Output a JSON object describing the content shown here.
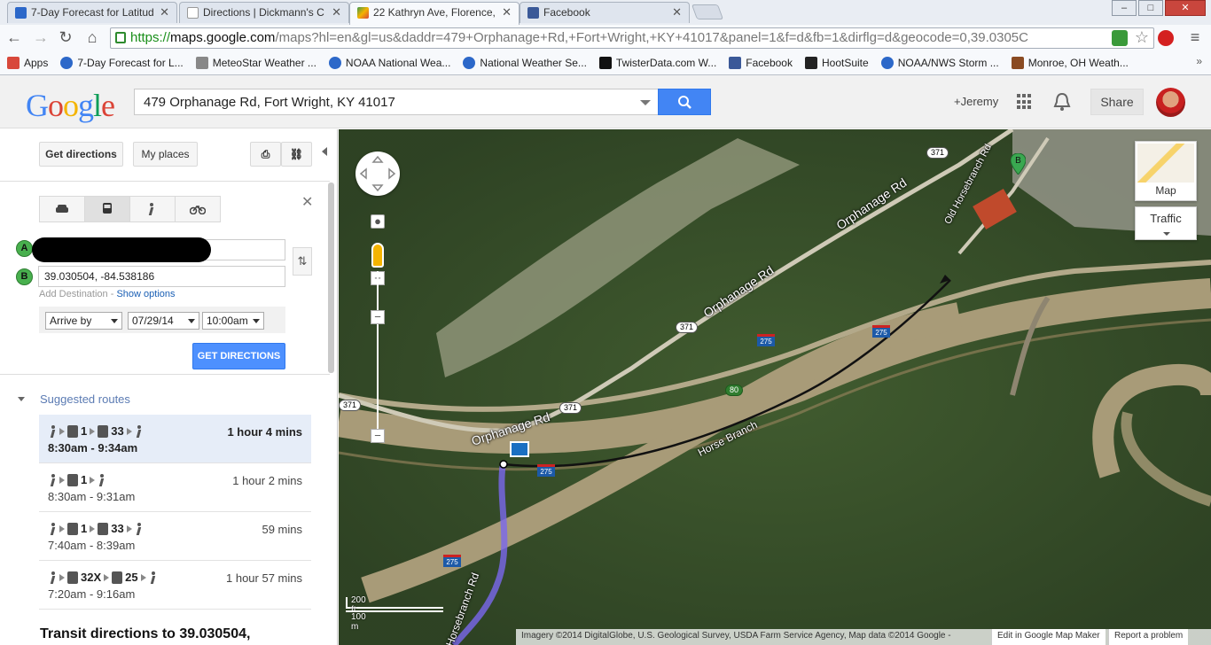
{
  "browser": {
    "tabs": [
      {
        "title": "7-Day Forecast for Latitud",
        "color": "#2c68c9"
      },
      {
        "title": "Directions | Dickmann's C",
        "color": "#aaaaaa"
      },
      {
        "title": "22 Kathryn Ave, Florence,",
        "color": "#3d9a4c"
      },
      {
        "title": "Facebook",
        "color": "#3b5998"
      }
    ],
    "window_buttons": {
      "minimize": "–",
      "maximize": "□",
      "close": "✕"
    },
    "url": {
      "scheme": "https://",
      "domain": "maps.google.com",
      "rest": "/maps?hl=en&gl=us&daddr=479+Orphanage+Rd,+Fort+Wright,+KY+41017&panel=1&f=d&fb=1&dirflg=d&geocode=0,39.0305C"
    },
    "bookmarks": [
      {
        "label": "Apps",
        "color": "#d8483b"
      },
      {
        "label": "7-Day Forecast for L...",
        "color": "#2c68c9"
      },
      {
        "label": "MeteoStar Weather ...",
        "color": "#888888"
      },
      {
        "label": "NOAA National Wea...",
        "color": "#2c68c9"
      },
      {
        "label": "National Weather Se...",
        "color": "#2c68c9"
      },
      {
        "label": "TwisterData.com W...",
        "color": "#111111"
      },
      {
        "label": "Facebook",
        "color": "#3b5998"
      },
      {
        "label": "HootSuite",
        "color": "#222222"
      },
      {
        "label": "NOAA/NWS Storm ...",
        "color": "#2c68c9"
      },
      {
        "label": "Monroe, OH Weath...",
        "color": "#8a4b22"
      }
    ]
  },
  "header": {
    "logo": "Google",
    "search_value": "479 Orphanage Rd, Fort Wright, KY 41017",
    "user": "+Jeremy",
    "share": "Share"
  },
  "panel": {
    "get_directions": "Get directions",
    "my_places": "My places",
    "marker_a": "A",
    "marker_b": "B",
    "destination": "39.030504, -84.538186",
    "add_destination": "Add Destination",
    "link_separator": "-",
    "show_options": "Show options",
    "arrive_by": "Arrive by",
    "date": "07/29/14",
    "time": "10:00am",
    "get_directions_btn": "GET DIRECTIONS",
    "suggested_routes": "Suggested routes",
    "routes": [
      {
        "legs": [
          "1",
          "33"
        ],
        "duration": "1 hour 4 mins",
        "times": "8:30am - 9:34am",
        "selected": true
      },
      {
        "legs": [
          "1"
        ],
        "duration": "1 hour 2 mins",
        "times": "8:30am - 9:31am",
        "selected": false
      },
      {
        "legs": [
          "1",
          "33"
        ],
        "duration": "59 mins",
        "times": "7:40am - 8:39am",
        "selected": false
      },
      {
        "legs": [
          "32X",
          "25"
        ],
        "duration": "1 hour 57 mins",
        "times": "7:20am - 9:16am",
        "selected": false
      }
    ],
    "transit_title": "Transit directions to 39.030504,"
  },
  "map": {
    "map_toggle": "Map",
    "traffic": "Traffic",
    "marker_b": "B",
    "roads": {
      "orphanage_1": "Orphanage Rd",
      "orphanage_2": "Orphanage Rd",
      "orphanage_3": "Orphanage Rd",
      "old_horsebranch": "Old Horsebranch Rd",
      "horse_branch": "Horse Branch",
      "horsebranch": "Horsebranch Rd"
    },
    "shields": {
      "s371a": "371",
      "s371b": "371",
      "s371c": "371",
      "s371d": "371",
      "s80": "80"
    },
    "interstates": {
      "i1": "275",
      "i2": "275",
      "i3": "275",
      "i4": "275"
    },
    "scale_ft": "200 ft",
    "scale_m": "100 m",
    "attribution": "Imagery ©2014 DigitalGlobe, U.S. Geological Survey, USDA Farm Service Agency, Map data ©2014 Google -",
    "edit_link": "Edit in Google Map Maker",
    "report": "Report a problem"
  }
}
